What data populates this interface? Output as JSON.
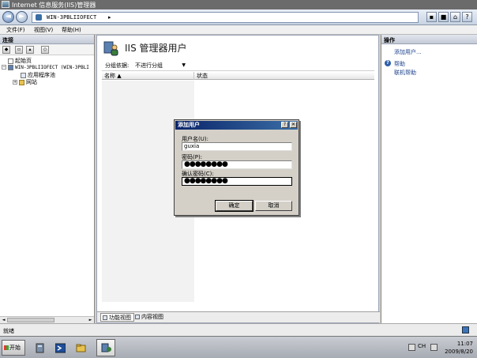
{
  "window": {
    "title": "Internet 信息服务(IIS)管理器"
  },
  "address": {
    "crumbs": [
      "WIN-3PBLIIOFECT",
      "▸"
    ]
  },
  "menu": {
    "items": [
      "文件(F)",
      "视图(V)",
      "帮助(H)"
    ]
  },
  "connections": {
    "header": "连接",
    "tree": [
      {
        "label": "起始页"
      },
      {
        "label": "WIN-3PBLIIOFECT (WIN-3PBLI"
      },
      {
        "label": "应用程序池"
      },
      {
        "label": "网站"
      }
    ]
  },
  "feature": {
    "title": "IIS 管理器用户",
    "group_label": "分组依据:",
    "group_value": "不进行分组",
    "columns": [
      "名称 ▲",
      "状态"
    ],
    "tabs": [
      "功能视图",
      "内容视图"
    ]
  },
  "actions": {
    "header": "操作",
    "items": [
      "添加用户...",
      "帮助",
      "联机帮助"
    ]
  },
  "status": {
    "text": "就绪"
  },
  "dialog": {
    "title": "添加用户",
    "help_btn": "?",
    "close_btn": "✕",
    "username_label": "用户名(U):",
    "username_value": "guxia",
    "password_label": "密码(P):",
    "password_value": "●●●●●●●●",
    "confirm_label": "确认密码(C):",
    "confirm_value": "●●●●●●●●",
    "ok": "确定",
    "cancel": "取消"
  },
  "taskbar": {
    "start": "开始",
    "clock_time": "11:07",
    "clock_date": "2009/8/20"
  }
}
